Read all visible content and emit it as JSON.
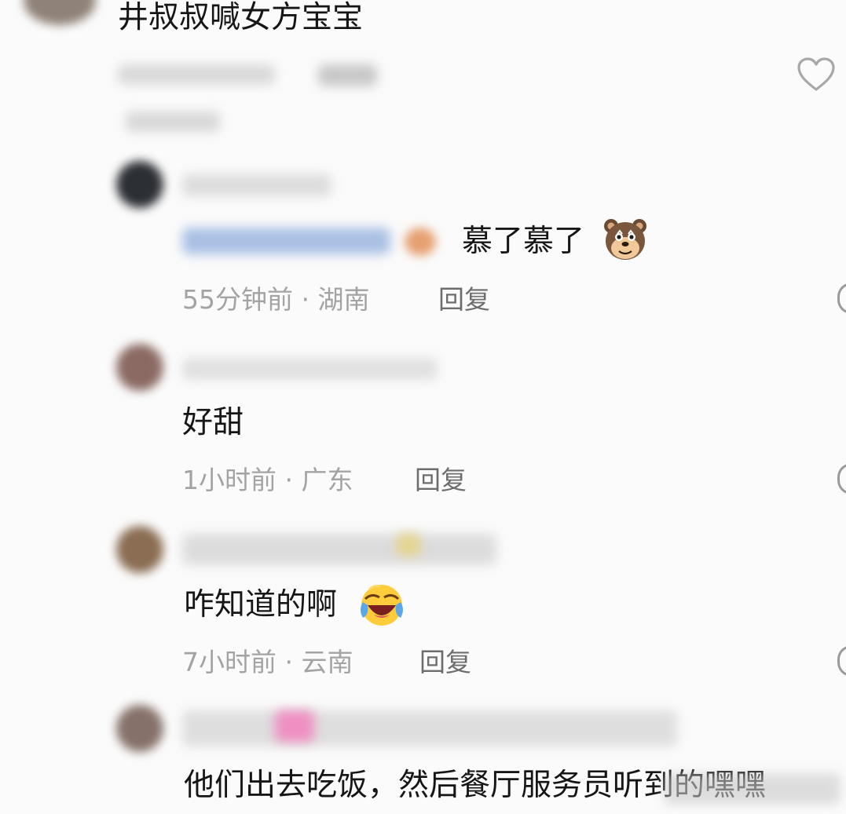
{
  "top_comment": {
    "text": "井叔叔喊女方宝宝"
  },
  "replies": [
    {
      "text": "慕了慕了",
      "time": "55分钟前",
      "region": "湖南",
      "reply_label": "回复"
    },
    {
      "text": "好甜",
      "time": "1小时前",
      "region": "广东",
      "reply_label": "回复"
    },
    {
      "text": "咋知道的啊",
      "time": "7小时前",
      "region": "云南",
      "reply_label": "回复"
    },
    {
      "text": "他们出去吃饭，然后餐厅服务员听到的嘿嘿"
    }
  ],
  "separator": "·",
  "icons": {
    "like": "heart-outline-icon",
    "bear_emoji": "bear-face-emoji",
    "laugh_emoji": "laugh-tears-emoji"
  },
  "colors": {
    "background": "#fbfbfb",
    "text": "#161616",
    "meta": "#a3a3a3",
    "reply": "#6d6d6d",
    "mention_blue": "#9db8e0"
  }
}
